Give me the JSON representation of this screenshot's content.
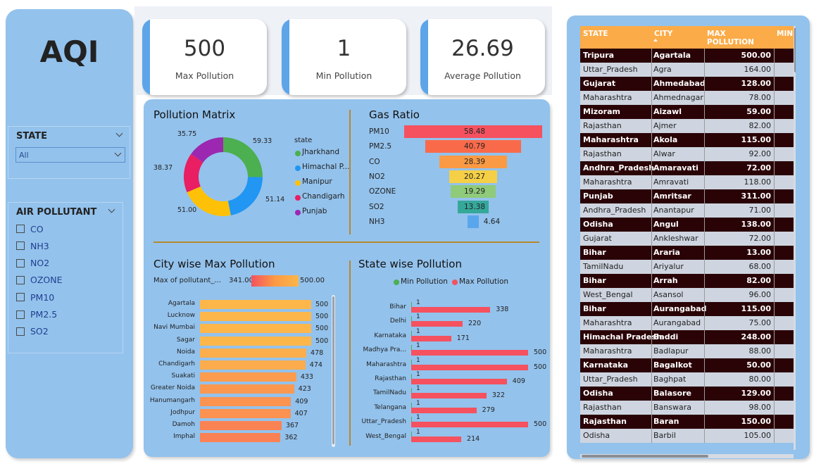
{
  "app": {
    "title": "AQI"
  },
  "kpis": [
    {
      "value": "500",
      "label": "Max Pollution"
    },
    {
      "value": "1",
      "label": "Min Pollution"
    },
    {
      "value": "26.69",
      "label": "Average Pollution"
    }
  ],
  "filters": {
    "state": {
      "title": "STATE",
      "selected": "All"
    },
    "pollutant": {
      "title": "AIR POLLUTANT",
      "options": [
        "CO",
        "NH3",
        "NO2",
        "OZONE",
        "PM10",
        "PM2.5",
        "SO2"
      ]
    }
  },
  "chart_data": [
    {
      "id": "pollution_matrix",
      "type": "pie",
      "title": "Pollution Matrix",
      "legend_title": "state",
      "legend_position": "right",
      "categories": [
        "Jharkhand",
        "Himachal P...",
        "Manipur",
        "Chandigarh",
        "Punjab"
      ],
      "values": [
        59.33,
        51.14,
        51.0,
        38.37,
        35.75
      ],
      "value_labels": [
        "59.33",
        "51.14",
        "51.00",
        "38.37",
        "35.75"
      ],
      "colors": [
        "#4caf50",
        "#2196f3",
        "#ffc107",
        "#e91e63",
        "#9c27b0"
      ]
    },
    {
      "id": "gas_ratio",
      "type": "bar",
      "orientation": "funnel",
      "title": "Gas Ratio",
      "categories": [
        "PM10",
        "PM2.5",
        "CO",
        "NO2",
        "OZONE",
        "SO2",
        "NH3"
      ],
      "values": [
        58.48,
        40.79,
        28.39,
        20.27,
        19.29,
        13.38,
        4.64
      ],
      "value_labels": [
        "58.48",
        "40.79",
        "28.39",
        "20.27",
        "19.29",
        "13.38",
        "4.64"
      ],
      "colors": [
        "#f5515f",
        "#f96a4b",
        "#fb9a44",
        "#f5cf46",
        "#8fcb7a",
        "#35a89a",
        "#5aa6ec"
      ]
    },
    {
      "id": "city_max",
      "type": "bar",
      "orientation": "horizontal",
      "title": "City wise Max Pollution",
      "legend_title": "Max of pollutant_...",
      "legend_min": "341.00",
      "legend_max": "500.00",
      "categories": [
        "Agartala",
        "Lucknow",
        "Navi Mumbai",
        "Sagar",
        "Noida",
        "Chandigarh",
        "Suakati",
        "Greater Noida",
        "Hanumangarh",
        "Jodhpur",
        "Damoh",
        "Imphal"
      ],
      "values": [
        500,
        500,
        500,
        500,
        478,
        474,
        433,
        423,
        409,
        407,
        367,
        362
      ],
      "value_labels": [
        "500",
        "500",
        "500",
        "500",
        "478",
        "474",
        "433",
        "423",
        "409",
        "407",
        "367",
        "362"
      ],
      "xlim": [
        0,
        500
      ]
    },
    {
      "id": "state_wise",
      "type": "bar",
      "orientation": "horizontal",
      "title": "State wise Pollution",
      "legend_position": "top",
      "categories": [
        "Bihar",
        "Delhi",
        "Karnataka",
        "Madhya Pra...",
        "Maharashtra",
        "Rajasthan",
        "TamilNadu",
        "Telangana",
        "Uttar_Pradesh",
        "West_Bengal"
      ],
      "series": [
        {
          "name": "Min Pollution",
          "color": "#4caf50",
          "values": [
            1,
            1,
            1,
            1,
            1,
            1,
            1,
            1,
            1,
            1
          ],
          "value_labels": [
            "1",
            "1",
            "1",
            "1",
            "1",
            "1",
            "1",
            "1",
            "1",
            "1"
          ]
        },
        {
          "name": "Max Pollution",
          "color": "#f5515f",
          "values": [
            338,
            220,
            171,
            500,
            500,
            409,
            322,
            279,
            500,
            214
          ],
          "value_labels": [
            "338",
            "220",
            "171",
            "500",
            "500",
            "409",
            "322",
            "279",
            "500",
            "214"
          ]
        }
      ],
      "xlim": [
        0,
        500
      ]
    }
  ],
  "table": {
    "columns": [
      "STATE",
      "CITY",
      "MAX POLLUTION",
      "MIN"
    ],
    "rows": [
      {
        "state": "Tripura",
        "city": "Agartala",
        "max": "500.00"
      },
      {
        "state": "Uttar_Pradesh",
        "city": "Agra",
        "max": "164.00"
      },
      {
        "state": "Gujarat",
        "city": "Ahmedabad",
        "max": "128.00"
      },
      {
        "state": "Maharashtra",
        "city": "Ahmednagar",
        "max": "78.00"
      },
      {
        "state": "Mizoram",
        "city": "Aizawl",
        "max": "59.00"
      },
      {
        "state": "Rajasthan",
        "city": "Ajmer",
        "max": "82.00"
      },
      {
        "state": "Maharashtra",
        "city": "Akola",
        "max": "115.00"
      },
      {
        "state": "Rajasthan",
        "city": "Alwar",
        "max": "92.00"
      },
      {
        "state": "Andhra_Pradesh",
        "city": "Amaravati",
        "max": "72.00"
      },
      {
        "state": "Maharashtra",
        "city": "Amravati",
        "max": "118.00"
      },
      {
        "state": "Punjab",
        "city": "Amritsar",
        "max": "311.00"
      },
      {
        "state": "Andhra_Pradesh",
        "city": "Anantapur",
        "max": "71.00"
      },
      {
        "state": "Odisha",
        "city": "Angul",
        "max": "138.00"
      },
      {
        "state": "Gujarat",
        "city": "Ankleshwar",
        "max": "72.00"
      },
      {
        "state": "Bihar",
        "city": "Araria",
        "max": "13.00"
      },
      {
        "state": "TamilNadu",
        "city": "Ariyalur",
        "max": "68.00"
      },
      {
        "state": "Bihar",
        "city": "Arrah",
        "max": "82.00"
      },
      {
        "state": "West_Bengal",
        "city": "Asansol",
        "max": "96.00"
      },
      {
        "state": "Bihar",
        "city": "Aurangabad",
        "max": "115.00"
      },
      {
        "state": "Maharashtra",
        "city": "Aurangabad",
        "max": "75.00"
      },
      {
        "state": "Himachal Pradesh",
        "city": "Baddi",
        "max": "248.00"
      },
      {
        "state": "Maharashtra",
        "city": "Badlapur",
        "max": "88.00"
      },
      {
        "state": "Karnataka",
        "city": "Bagalkot",
        "max": "50.00"
      },
      {
        "state": "Uttar_Pradesh",
        "city": "Baghpat",
        "max": "80.00"
      },
      {
        "state": "Odisha",
        "city": "Balasore",
        "max": "129.00"
      },
      {
        "state": "Rajasthan",
        "city": "Banswara",
        "max": "98.00"
      },
      {
        "state": "Rajasthan",
        "city": "Baran",
        "max": "150.00"
      },
      {
        "state": "Odisha",
        "city": "Barbil",
        "max": "105.00"
      }
    ]
  }
}
